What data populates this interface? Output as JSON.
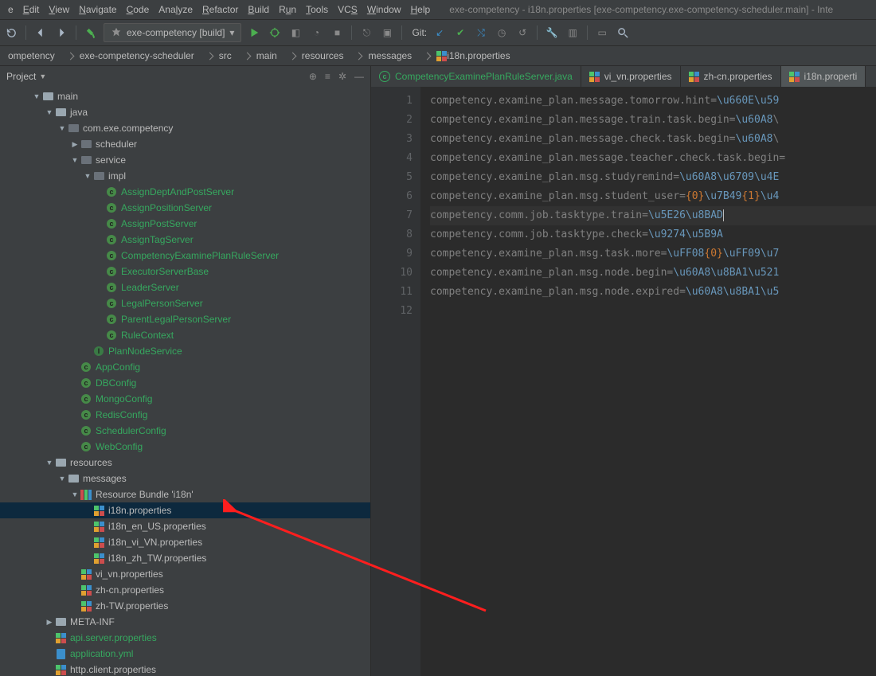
{
  "window_title": "exe-competency - i18n.properties [exe-competency.exe-competency-scheduler.main] - Inte",
  "menu": [
    "e",
    "Edit",
    "View",
    "Navigate",
    "Code",
    "Analyze",
    "Refactor",
    "Build",
    "Run",
    "Tools",
    "VCS",
    "Window",
    "Help"
  ],
  "menu_underline_idx": {
    "Edit": 0,
    "View": 0,
    "Navigate": 0,
    "Code": 0,
    "Analyze": 3,
    "Refactor": 0,
    "Build": 0,
    "Run": 1,
    "Tools": 0,
    "VCS": 2,
    "Window": 0,
    "Help": 0
  },
  "run_config": "exe-competency [build]",
  "git_label": "Git:",
  "breadcrumbs": [
    "ompetency",
    "exe-competency-scheduler",
    "src",
    "main",
    "resources",
    "messages",
    "i18n.properties"
  ],
  "project_label": "Project",
  "tabs": [
    {
      "label": "CompetencyExaminePlanRuleServer.java",
      "kind": "class"
    },
    {
      "label": "vi_vn.properties",
      "kind": "prop"
    },
    {
      "label": "zh-cn.properties",
      "kind": "prop"
    },
    {
      "label": "i18n.properti",
      "kind": "prop",
      "active": true
    }
  ],
  "tree": [
    {
      "d": 2,
      "t": "▼",
      "k": "folder",
      "label": "main"
    },
    {
      "d": 3,
      "t": "▼",
      "k": "folder",
      "label": "java"
    },
    {
      "d": 4,
      "t": "▼",
      "k": "pkg",
      "label": "com.exe.competency"
    },
    {
      "d": 5,
      "t": "▶",
      "k": "pkg",
      "label": "scheduler"
    },
    {
      "d": 5,
      "t": "▼",
      "k": "pkg",
      "label": "service"
    },
    {
      "d": 6,
      "t": "▼",
      "k": "pkg",
      "label": "impl"
    },
    {
      "d": 7,
      "t": "",
      "k": "class",
      "label": "AssignDeptAndPostServer"
    },
    {
      "d": 7,
      "t": "",
      "k": "class",
      "label": "AssignPositionServer"
    },
    {
      "d": 7,
      "t": "",
      "k": "class",
      "label": "AssignPostServer"
    },
    {
      "d": 7,
      "t": "",
      "k": "class",
      "label": "AssignTagServer"
    },
    {
      "d": 7,
      "t": "",
      "k": "class",
      "label": "CompetencyExaminePlanRuleServer"
    },
    {
      "d": 7,
      "t": "",
      "k": "class",
      "label": "ExecutorServerBase"
    },
    {
      "d": 7,
      "t": "",
      "k": "class",
      "label": "LeaderServer"
    },
    {
      "d": 7,
      "t": "",
      "k": "class",
      "label": "LegalPersonServer"
    },
    {
      "d": 7,
      "t": "",
      "k": "class",
      "label": "ParentLegalPersonServer"
    },
    {
      "d": 7,
      "t": "",
      "k": "class",
      "label": "RuleContext"
    },
    {
      "d": 6,
      "t": "",
      "k": "if",
      "label": "PlanNodeService"
    },
    {
      "d": 5,
      "t": "",
      "k": "class",
      "label": "AppConfig"
    },
    {
      "d": 5,
      "t": "",
      "k": "class",
      "label": "DBConfig"
    },
    {
      "d": 5,
      "t": "",
      "k": "class",
      "label": "MongoConfig"
    },
    {
      "d": 5,
      "t": "",
      "k": "class",
      "label": "RedisConfig"
    },
    {
      "d": 5,
      "t": "",
      "k": "class",
      "label": "SchedulerConfig"
    },
    {
      "d": 5,
      "t": "",
      "k": "class",
      "label": "WebConfig"
    },
    {
      "d": 3,
      "t": "▼",
      "k": "folder",
      "label": "resources"
    },
    {
      "d": 4,
      "t": "▼",
      "k": "folder",
      "label": "messages"
    },
    {
      "d": 5,
      "t": "▼",
      "k": "bundle",
      "label": "Resource Bundle 'i18n'"
    },
    {
      "d": 6,
      "t": "",
      "k": "prop",
      "label": "i18n.properties",
      "sel": true
    },
    {
      "d": 6,
      "t": "",
      "k": "prop",
      "label": "i18n_en_US.properties"
    },
    {
      "d": 6,
      "t": "",
      "k": "prop",
      "label": "i18n_vi_VN.properties"
    },
    {
      "d": 6,
      "t": "",
      "k": "prop",
      "label": "i18n_zh_TW.properties"
    },
    {
      "d": 5,
      "t": "",
      "k": "prop",
      "label": "vi_vn.properties"
    },
    {
      "d": 5,
      "t": "",
      "k": "prop",
      "label": "zh-cn.properties"
    },
    {
      "d": 5,
      "t": "",
      "k": "prop",
      "label": "zh-TW.properties"
    },
    {
      "d": 3,
      "t": "▶",
      "k": "folder",
      "label": "META-INF"
    },
    {
      "d": 3,
      "t": "",
      "k": "prop",
      "label": "api.server.properties",
      "cls": "legend-green"
    },
    {
      "d": 3,
      "t": "",
      "k": "yml",
      "label": "application.yml",
      "cls": "legend-green"
    },
    {
      "d": 3,
      "t": "",
      "k": "prop",
      "label": "http.client.properties"
    }
  ],
  "code": [
    {
      "n": 1,
      "key": "competency.examine_plan.message.tomorrow.hint",
      "val": "\\u660E\\u59"
    },
    {
      "n": 2,
      "key": "competency.examine_plan.message.train.task.begin",
      "val": "\\u60A8\\"
    },
    {
      "n": 3,
      "key": "competency.examine_plan.message.check.task.begin",
      "val": "\\u60A8\\"
    },
    {
      "n": 4,
      "key": "competency.examine_plan.message.teacher.check.task.begin",
      "val": ""
    },
    {
      "n": 5,
      "key": "competency.examine_plan.msg.studyremind",
      "val": "\\u60A8\\u6709\\u4E"
    },
    {
      "n": 6,
      "key": "competency.examine_plan.msg.student_user",
      "val": "{0}\\u7B49{1}\\u4"
    },
    {
      "n": 7,
      "key": "competency.comm.job.tasktype.train",
      "val": "\\u5E26\\u8BAD",
      "caret": true
    },
    {
      "n": 8,
      "key": "competency.comm.job.tasktype.check",
      "val": "\\u9274\\u5B9A"
    },
    {
      "n": 9,
      "key": "competency.examine_plan.msg.task.more",
      "val": "\\uFF08{0}\\uFF09\\u7"
    },
    {
      "n": 10,
      "key": "competency.examine_plan.msg.node.begin",
      "val": "\\u60A8\\u8BA1\\u521"
    },
    {
      "n": 11,
      "key": "competency.examine_plan.msg.node.expired",
      "val": "\\u60A8\\u8BA1\\u5"
    },
    {
      "n": 12,
      "key": "",
      "val": ""
    }
  ]
}
